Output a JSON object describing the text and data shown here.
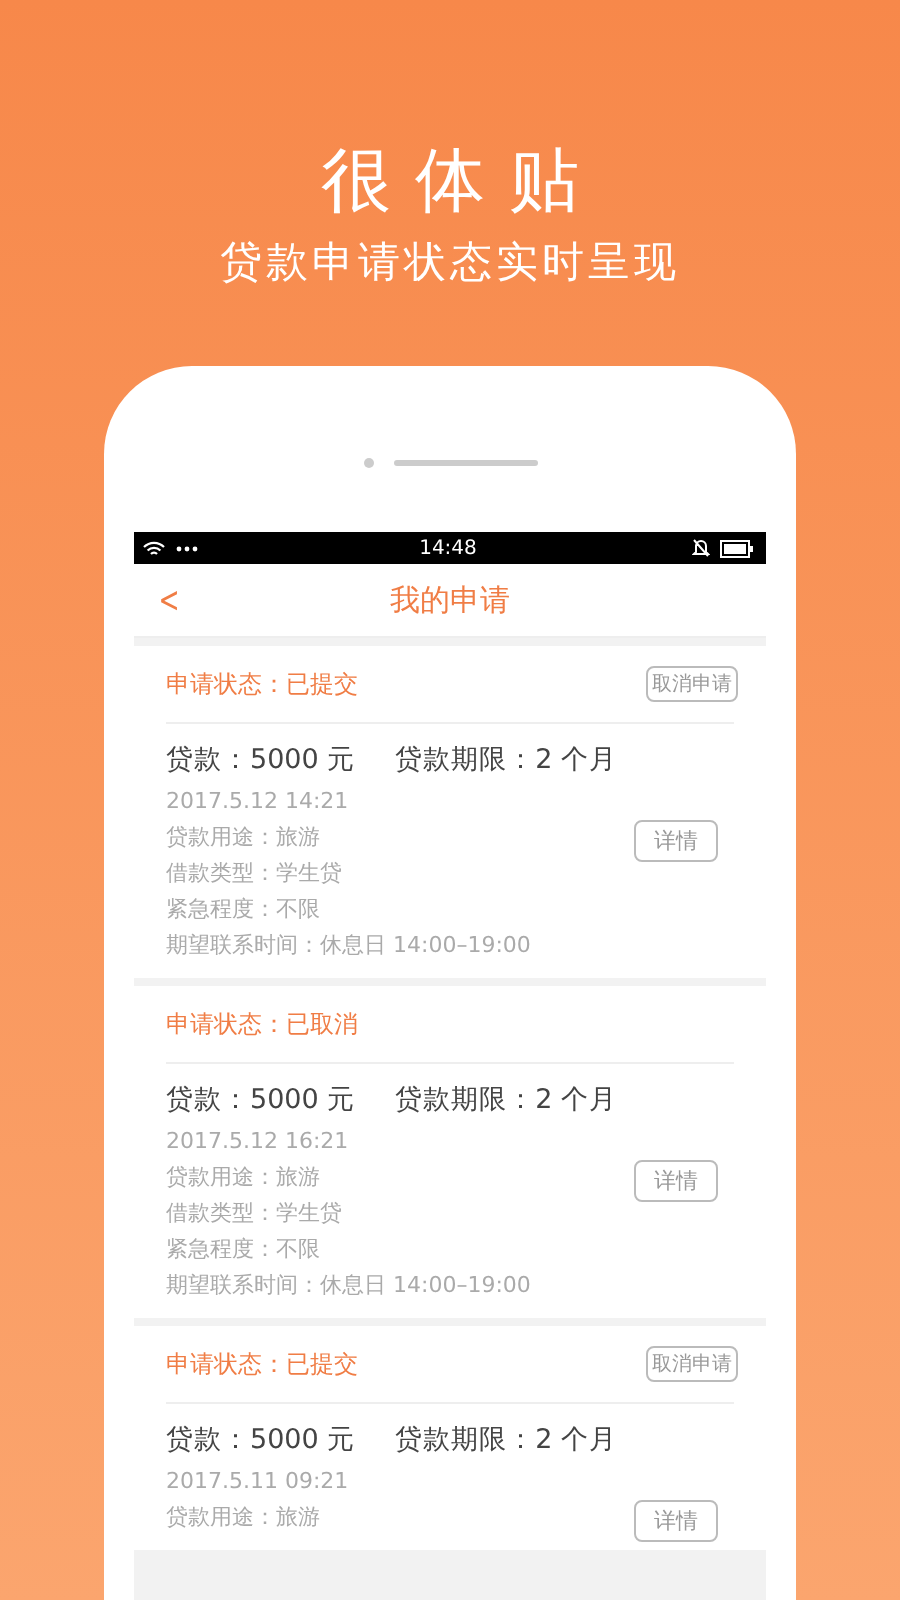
{
  "headline": "很体贴",
  "subtitle": "贷款申请状态实时呈现",
  "status_bar": {
    "time": "14:48"
  },
  "nav": {
    "back": "<",
    "title": "我的申请"
  },
  "applications": [
    {
      "status": "申请状态：已提交",
      "cancel_button": "取消申请",
      "amount": "贷款：5000 元",
      "term": "贷款期限：2 个月",
      "date": "2017.5.12 14:21",
      "details": [
        "贷款用途：旅游",
        "借款类型：学生贷",
        "紧急程度：不限",
        "期望联系时间：休息日 14:00–19:00"
      ],
      "details_button": "详情"
    },
    {
      "status": "申请状态：已取消",
      "amount": "贷款：5000 元",
      "term": "贷款期限：2 个月",
      "date": "2017.5.12 16:21",
      "details": [
        "贷款用途：旅游",
        "借款类型：学生贷",
        "紧急程度：不限",
        "期望联系时间：休息日 14:00–19:00"
      ],
      "details_button": "详情"
    },
    {
      "status": "申请状态：已提交",
      "cancel_button": "取消申请",
      "amount": "贷款：5000 元",
      "term": "贷款期限：2 个月",
      "date": "2017.5.11 09:21",
      "details": [
        "贷款用途：旅游"
      ],
      "details_button": "详情"
    }
  ]
}
